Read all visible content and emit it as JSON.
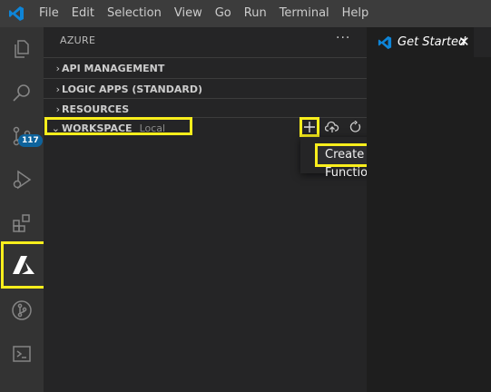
{
  "menubar": {
    "items": [
      "File",
      "Edit",
      "Selection",
      "View",
      "Go",
      "Run",
      "Terminal",
      "Help"
    ]
  },
  "activity_bar": {
    "items": [
      "explorer-icon",
      "search-icon",
      "source-control-icon",
      "run-debug-icon",
      "extensions-icon",
      "azure-icon",
      "git-graph-icon",
      "terminal-icon"
    ],
    "active": "azure-icon",
    "source_control_badge": "117"
  },
  "sidebar": {
    "title": "AZURE",
    "more_label": "···",
    "sections": [
      {
        "label": "API MANAGEMENT",
        "chevron": "›"
      },
      {
        "label": "LOGIC APPS (STANDARD)",
        "chevron": "›"
      },
      {
        "label": "RESOURCES",
        "chevron": "›"
      },
      {
        "label": "WORKSPACE",
        "chevron": "⌄",
        "description": "Local"
      }
    ],
    "workspace_actions": [
      "add-icon",
      "deploy-cloud-icon",
      "refresh-icon"
    ]
  },
  "context_menu": {
    "items": [
      "Create Function..."
    ]
  },
  "editor": {
    "tab_label": "Get Started",
    "tab_close": "✕"
  },
  "colors": {
    "highlight": "#f9ee1c",
    "vscode_blue": "#0e85d8",
    "badge": "#0e639c"
  }
}
